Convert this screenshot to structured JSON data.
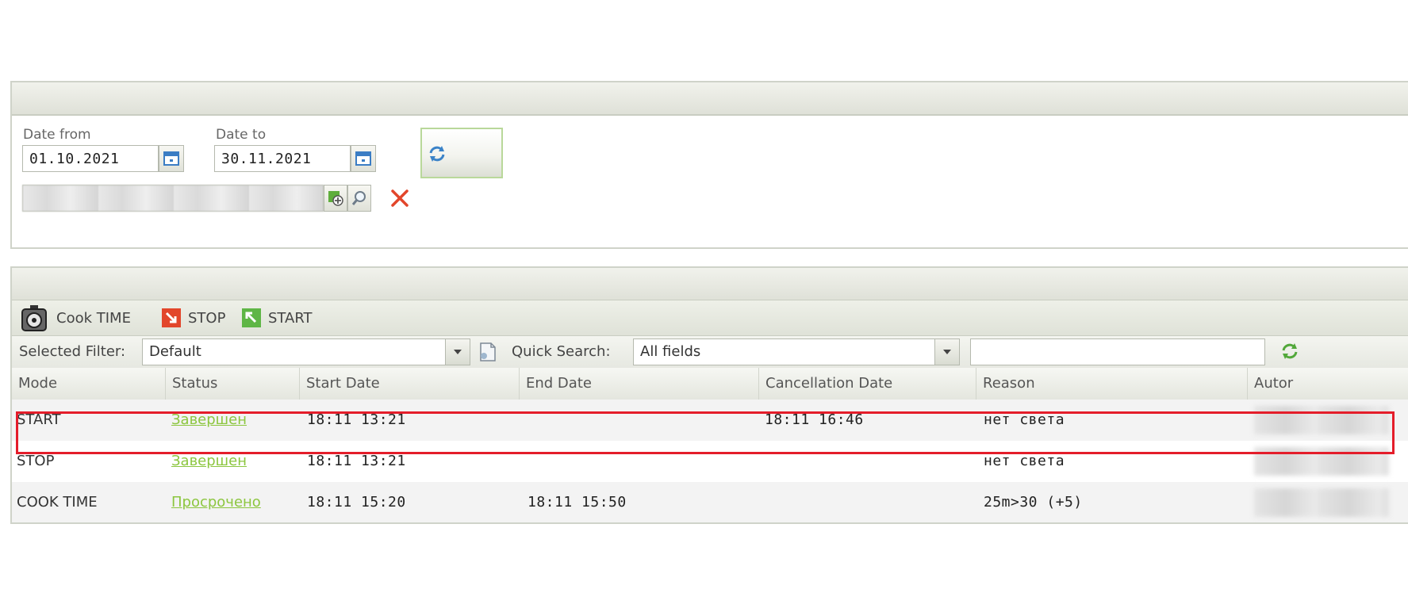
{
  "filters": {
    "date_from_label": "Date from",
    "date_from_value": "01.10.2021",
    "date_to_label": "Date to",
    "date_to_value": "30.11.2021"
  },
  "toolbar": {
    "cook_time_label": "Cook TIME",
    "stop_label": "STOP",
    "start_label": "START"
  },
  "filterbar": {
    "selected_filter_label": "Selected Filter:",
    "selected_filter_value": "Default",
    "quick_search_label": "Quick Search:",
    "quick_search_value": "All fields",
    "search_value": ""
  },
  "grid": {
    "columns": [
      "Mode",
      "Status",
      "Start Date",
      "End Date",
      "Cancellation Date",
      "Reason",
      "Autor"
    ],
    "rows": [
      {
        "mode": "START",
        "status": "Завершен",
        "start": "18:11 13:21",
        "end": "",
        "cancel": "18:11 16:46",
        "reason": "нет света"
      },
      {
        "mode": "STOP",
        "status": "Завершен",
        "start": "18:11 13:21",
        "end": "",
        "cancel": "",
        "reason": "нет света"
      },
      {
        "mode": "COOK TIME",
        "status": "Просрочено",
        "start": "18:11 15:20",
        "end": "18:11 15:50",
        "cancel": "",
        "reason": "25m>30 (+5)"
      }
    ]
  },
  "colors": {
    "accent_green": "#8cc63f",
    "highlight_red": "#e41d2a",
    "stop_red": "#e2462b",
    "start_green": "#5fb646"
  }
}
